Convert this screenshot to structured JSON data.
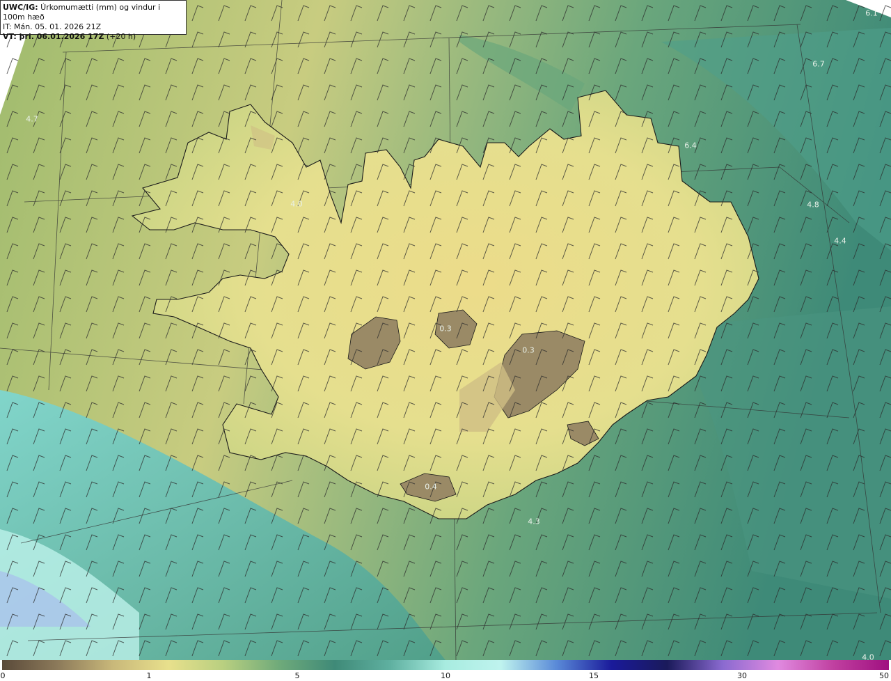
{
  "header": {
    "product": "UWC/IG:",
    "title": " Úrkomumætti (mm) og vindur i 100m hæð",
    "issue_time": "IT: Mán. 05. 01. 2026 21Z",
    "valid_prefix": "VT: þri. 06.01.2026 17Z",
    "valid_suffix": " (+20 h)"
  },
  "field_labels": [
    {
      "text": "6.1"
    },
    {
      "text": "6.7"
    },
    {
      "text": "4.7"
    },
    {
      "text": "6.4"
    },
    {
      "text": "4.0"
    },
    {
      "text": "4.8"
    },
    {
      "text": "4.4"
    },
    {
      "text": "0.3"
    },
    {
      "text": "0.3"
    },
    {
      "text": "0.4"
    },
    {
      "text": "4.3"
    },
    {
      "text": "4.0"
    }
  ],
  "colorbar": {
    "ticks": [
      "0",
      "1",
      "5",
      "10",
      "15",
      "30",
      "50"
    ],
    "colors": [
      "#5a4a3a",
      "#8c7a5a",
      "#c9b87a",
      "#e8e08c",
      "#b8cf80",
      "#6faa7a",
      "#3f8a78",
      "#5fb0a0",
      "#a8ece0",
      "#bff3ee",
      "#5a8ad8",
      "#1a1a9a",
      "#1a1a5a",
      "#8a6ad0",
      "#e08ae0",
      "#c040a0",
      "#a01080"
    ]
  },
  "colors": {
    "land_high": "#8a7a5a",
    "land_mid": "#e8e28c",
    "sea_low": "#c9cc7a",
    "sea_mid": "#5e9c78",
    "sea_high": "#8fe6d8",
    "coast": "#1a1a1a"
  }
}
